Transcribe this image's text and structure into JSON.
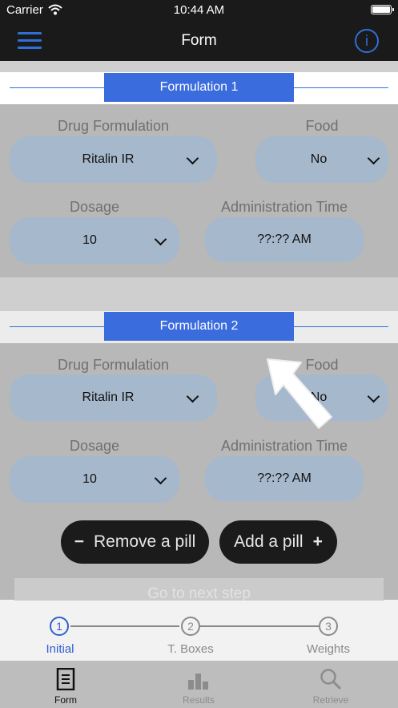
{
  "status_bar": {
    "carrier": "Carrier",
    "time": "10:44 AM"
  },
  "nav": {
    "title": "Form",
    "menu_icon": "hamburger-menu-icon",
    "info_icon": "info-icon",
    "info_glyph": "i"
  },
  "formulations": [
    {
      "header": "Formulation 1",
      "drug_label": "Drug Formulation",
      "drug_value": "Ritalin IR",
      "food_label": "Food",
      "food_value": "No",
      "dosage_label": "Dosage",
      "dosage_value": "10",
      "time_label": "Administration Time",
      "time_value": "??:?? AM"
    },
    {
      "header": "Formulation 2",
      "drug_label": "Drug Formulation",
      "drug_value": "Ritalin IR",
      "food_label": "Food",
      "food_value": "No",
      "dosage_label": "Dosage",
      "dosage_value": "10",
      "time_label": "Administration Time",
      "time_value": "??:?? AM"
    }
  ],
  "actions": {
    "remove_sign": "−",
    "remove_label": "Remove a pill",
    "add_label": "Add a pill",
    "add_sign": "+",
    "next_step": "Go to next step"
  },
  "stepper": {
    "steps": [
      {
        "number": "1",
        "label": "Initial",
        "active": true
      },
      {
        "number": "2",
        "label": "T. Boxes",
        "active": false
      },
      {
        "number": "3",
        "label": "Weights",
        "active": false
      }
    ]
  },
  "tabs": [
    {
      "label": "Form",
      "icon": "document-icon",
      "active": true
    },
    {
      "label": "Results",
      "icon": "bar-chart-icon",
      "active": false
    },
    {
      "label": "Retrieve",
      "icon": "search-icon",
      "active": false
    }
  ],
  "colors": {
    "accent": "#3b6cde",
    "nav_bg": "#1a1a1a",
    "select_bg": "#a6b8cc",
    "overlay": "#b8b8b8"
  },
  "overlay_hint": {
    "icon": "pointer-arrow-icon"
  }
}
